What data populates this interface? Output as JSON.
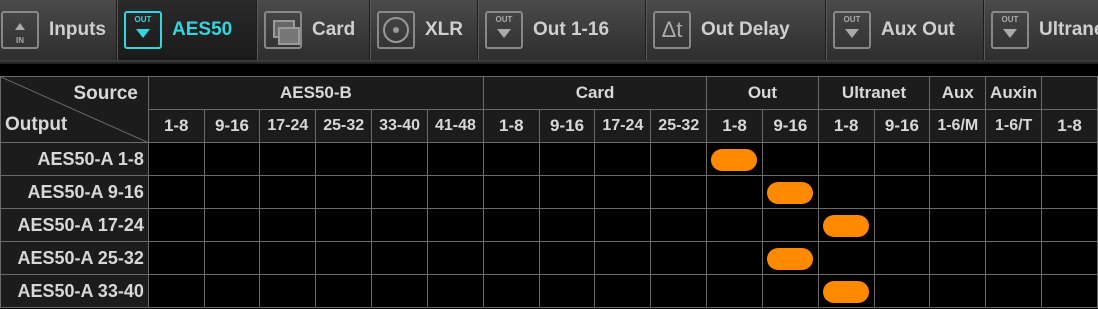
{
  "tabs": [
    {
      "label": "Inputs",
      "icon": "input-icon",
      "icon_top": "",
      "icon_bottom": "IN",
      "active": false
    },
    {
      "label": "AES50",
      "icon": "output-icon",
      "icon_top": "OUT",
      "icon_bottom": "",
      "active": true
    },
    {
      "label": "Card",
      "icon": "card-icon",
      "icon_top": "",
      "icon_bottom": "",
      "active": false
    },
    {
      "label": "XLR",
      "icon": "xlr-icon",
      "icon_top": "",
      "icon_bottom": "",
      "active": false
    },
    {
      "label": "Out 1-16",
      "icon": "output-icon",
      "icon_top": "OUT",
      "icon_bottom": "",
      "active": false
    },
    {
      "label": "Out Delay",
      "icon": "delay-icon",
      "icon_top": "",
      "icon_bottom": "",
      "active": false
    },
    {
      "label": "Aux Out",
      "icon": "output-icon",
      "icon_top": "OUT",
      "icon_bottom": "",
      "active": false
    },
    {
      "label": "Ultranet",
      "icon": "output-icon",
      "icon_top": "OUT",
      "icon_bottom": "",
      "active": false
    }
  ],
  "accent_color": "#35d5e0",
  "route_color": "#ff8a00",
  "matrix": {
    "corner_source": "Source",
    "corner_output": "Output",
    "groups": [
      {
        "label": "AES50-B",
        "cols": [
          "1-8",
          "9-16",
          "17-24",
          "25-32",
          "33-40",
          "41-48"
        ]
      },
      {
        "label": "Card",
        "cols": [
          "1-8",
          "9-16",
          "17-24",
          "25-32"
        ]
      },
      {
        "label": "Out",
        "cols": [
          "1-8",
          "9-16"
        ]
      },
      {
        "label": "Ultranet",
        "cols": [
          "1-8",
          "9-16"
        ]
      },
      {
        "label": "Aux",
        "cols": [
          "1-6/M"
        ]
      },
      {
        "label": "Auxin",
        "cols": [
          "1-6/T"
        ]
      },
      {
        "label": "",
        "cols": [
          "1-8"
        ]
      }
    ],
    "rows": [
      {
        "label": "AES50-A 1-8",
        "route_col": 10
      },
      {
        "label": "AES50-A 9-16",
        "route_col": 11
      },
      {
        "label": "AES50-A 17-24",
        "route_col": 12
      },
      {
        "label": "AES50-A 25-32",
        "route_col": 11
      },
      {
        "label": "AES50-A 33-40",
        "route_col": 12
      }
    ]
  }
}
